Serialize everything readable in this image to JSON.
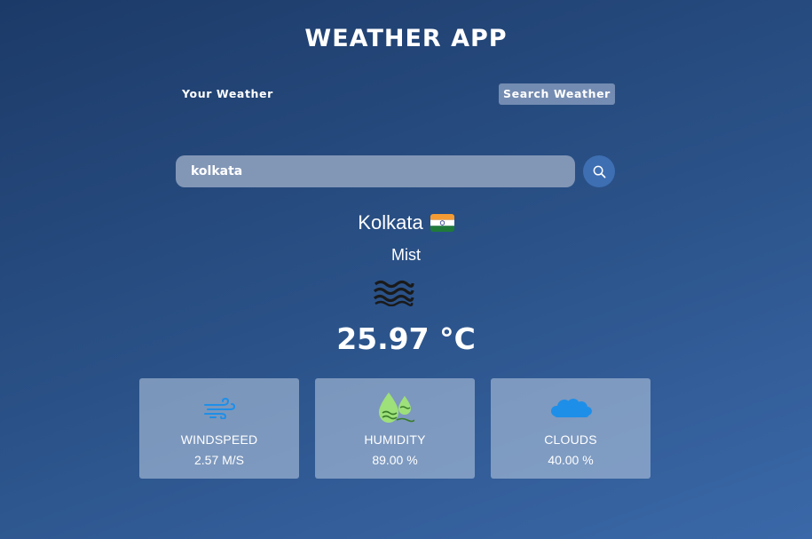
{
  "app": {
    "title": "WEATHER APP"
  },
  "tabs": {
    "your_weather": "Your Weather",
    "search_weather": "Search Weather"
  },
  "search": {
    "value": "kolkata",
    "icon": "search-icon"
  },
  "weather": {
    "city": "Kolkata",
    "country_flag": "india-flag-icon",
    "condition": "Mist",
    "condition_icon": "mist-icon",
    "temperature": "25.97 °C"
  },
  "stats": [
    {
      "label": "WINDSPEED",
      "value": "2.57 M/S",
      "icon": "wind-icon"
    },
    {
      "label": "HUMIDITY",
      "value": "89.00 %",
      "icon": "humidity-icon"
    },
    {
      "label": "CLOUDS",
      "value": "40.00 %",
      "icon": "cloud-icon"
    }
  ],
  "colors": {
    "background_start": "#1c3a68",
    "background_end": "#3a68a8",
    "search_button": "#3e6fb3",
    "icon_blue": "#1e8fe8",
    "humidity_green": "#9ee07a"
  }
}
